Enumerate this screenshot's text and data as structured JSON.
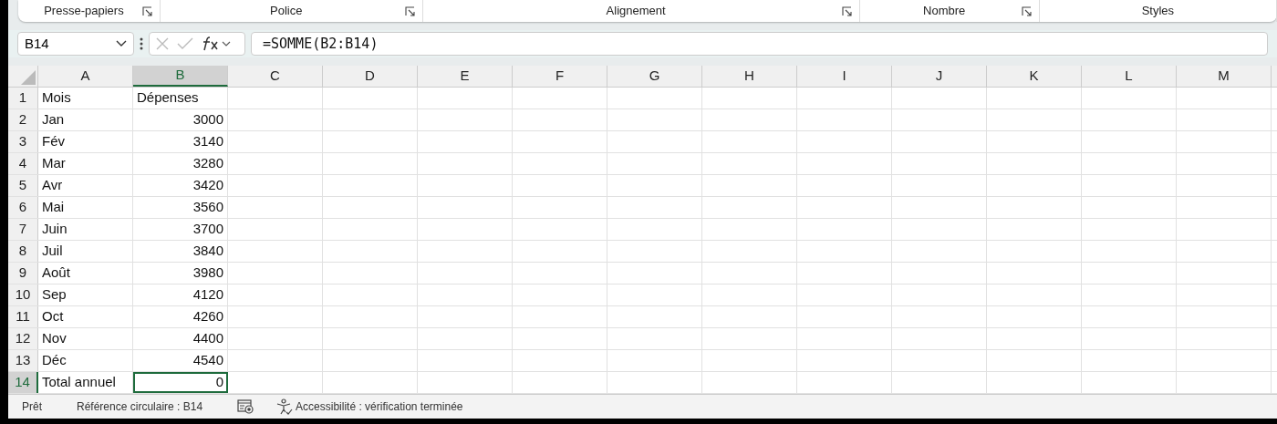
{
  "ribbon_groups": [
    {
      "label": "Presse-papiers",
      "launcher": true
    },
    {
      "label": "Police",
      "launcher": true
    },
    {
      "label": "Alignement",
      "launcher": true
    },
    {
      "label": "Nombre",
      "launcher": true
    },
    {
      "label": "Styles",
      "launcher": false
    }
  ],
  "name_box": "B14",
  "formula": "=SOMME(B2:B14)",
  "columns": [
    {
      "label": "A",
      "selected": false
    },
    {
      "label": "B",
      "selected": true
    },
    {
      "label": "C",
      "selected": false
    },
    {
      "label": "D",
      "selected": false
    },
    {
      "label": "E",
      "selected": false
    },
    {
      "label": "F",
      "selected": false
    },
    {
      "label": "G",
      "selected": false
    },
    {
      "label": "H",
      "selected": false
    },
    {
      "label": "I",
      "selected": false
    },
    {
      "label": "J",
      "selected": false
    },
    {
      "label": "K",
      "selected": false
    },
    {
      "label": "L",
      "selected": false
    },
    {
      "label": "M",
      "selected": false
    }
  ],
  "rows": [
    {
      "header": "1",
      "selected": false,
      "cells": [
        {
          "text": "Mois",
          "kind": "text",
          "selected": false
        },
        {
          "text": "Dépenses",
          "kind": "text",
          "selected": false
        }
      ]
    },
    {
      "header": "2",
      "selected": false,
      "cells": [
        {
          "text": "Jan",
          "kind": "text",
          "selected": false
        },
        {
          "text": "3000",
          "kind": "number",
          "selected": false
        }
      ]
    },
    {
      "header": "3",
      "selected": false,
      "cells": [
        {
          "text": "Fév",
          "kind": "text",
          "selected": false
        },
        {
          "text": "3140",
          "kind": "number",
          "selected": false
        }
      ]
    },
    {
      "header": "4",
      "selected": false,
      "cells": [
        {
          "text": "Mar",
          "kind": "text",
          "selected": false
        },
        {
          "text": "3280",
          "kind": "number",
          "selected": false
        }
      ]
    },
    {
      "header": "5",
      "selected": false,
      "cells": [
        {
          "text": "Avr",
          "kind": "text",
          "selected": false
        },
        {
          "text": "3420",
          "kind": "number",
          "selected": false
        }
      ]
    },
    {
      "header": "6",
      "selected": false,
      "cells": [
        {
          "text": "Mai",
          "kind": "text",
          "selected": false
        },
        {
          "text": "3560",
          "kind": "number",
          "selected": false
        }
      ]
    },
    {
      "header": "7",
      "selected": false,
      "cells": [
        {
          "text": "Juin",
          "kind": "text",
          "selected": false
        },
        {
          "text": "3700",
          "kind": "number",
          "selected": false
        }
      ]
    },
    {
      "header": "8",
      "selected": false,
      "cells": [
        {
          "text": "Juil",
          "kind": "text",
          "selected": false
        },
        {
          "text": "3840",
          "kind": "number",
          "selected": false
        }
      ]
    },
    {
      "header": "9",
      "selected": false,
      "cells": [
        {
          "text": "Août",
          "kind": "text",
          "selected": false
        },
        {
          "text": "3980",
          "kind": "number",
          "selected": false
        }
      ]
    },
    {
      "header": "10",
      "selected": false,
      "cells": [
        {
          "text": "Sep",
          "kind": "text",
          "selected": false
        },
        {
          "text": "4120",
          "kind": "number",
          "selected": false
        }
      ]
    },
    {
      "header": "11",
      "selected": false,
      "cells": [
        {
          "text": "Oct",
          "kind": "text",
          "selected": false
        },
        {
          "text": "4260",
          "kind": "number",
          "selected": false
        }
      ]
    },
    {
      "header": "12",
      "selected": false,
      "cells": [
        {
          "text": "Nov",
          "kind": "text",
          "selected": false
        },
        {
          "text": "4400",
          "kind": "number",
          "selected": false
        }
      ]
    },
    {
      "header": "13",
      "selected": false,
      "cells": [
        {
          "text": "Déc",
          "kind": "text",
          "selected": false
        },
        {
          "text": "4540",
          "kind": "number",
          "selected": false
        }
      ]
    },
    {
      "header": "14",
      "selected": true,
      "cells": [
        {
          "text": "Total annuel",
          "kind": "text",
          "selected": false
        },
        {
          "text": "0",
          "kind": "number",
          "selected": true
        }
      ]
    }
  ],
  "status_bar": {
    "mode": "Prêt",
    "circular_reference": "Référence circulaire : B14",
    "accessibility": "Accessibilité : vérification terminée"
  }
}
